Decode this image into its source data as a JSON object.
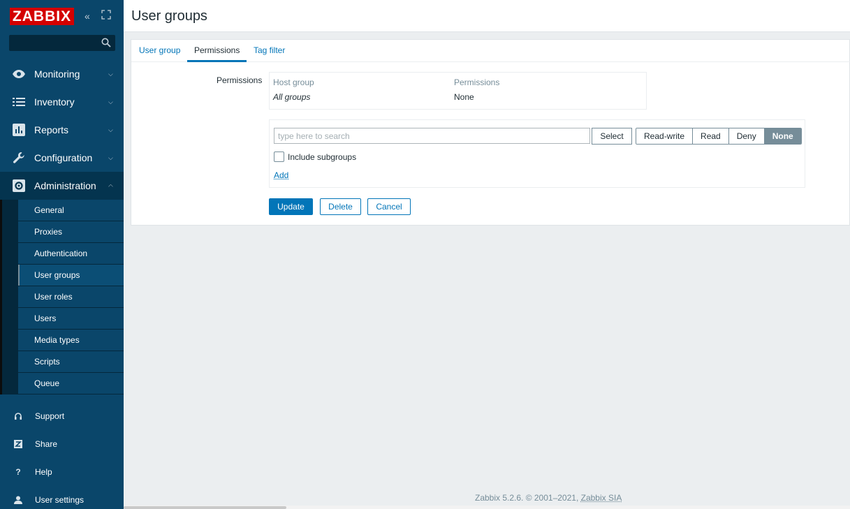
{
  "brand": {
    "logo": "ZABBIX",
    "color": "#d40000"
  },
  "sidebar": {
    "collapse_icon": "double-chevron-left-icon",
    "kiosk_icon": "expand-icon",
    "search_placeholder": "",
    "menu": [
      {
        "label": "Monitoring",
        "icon": "eye-icon"
      },
      {
        "label": "Inventory",
        "icon": "list-icon"
      },
      {
        "label": "Reports",
        "icon": "bar-chart-icon"
      },
      {
        "label": "Configuration",
        "icon": "wrench-icon"
      },
      {
        "label": "Administration",
        "icon": "gear-icon"
      }
    ],
    "submenu": [
      {
        "label": "General"
      },
      {
        "label": "Proxies"
      },
      {
        "label": "Authentication"
      },
      {
        "label": "User groups"
      },
      {
        "label": "User roles"
      },
      {
        "label": "Users"
      },
      {
        "label": "Media types"
      },
      {
        "label": "Scripts"
      },
      {
        "label": "Queue"
      }
    ],
    "bottom": [
      {
        "label": "Support",
        "icon": "headset-icon"
      },
      {
        "label": "Share",
        "icon": "share-z-icon"
      },
      {
        "label": "Help",
        "icon": "question-icon"
      },
      {
        "label": "User settings",
        "icon": "user-icon"
      }
    ]
  },
  "header": {
    "title": "User groups"
  },
  "tabs": [
    {
      "label": "User group"
    },
    {
      "label": "Permissions"
    },
    {
      "label": "Tag filter"
    }
  ],
  "permissions": {
    "field_label": "Permissions",
    "table": {
      "headers": [
        "Host group",
        "Permissions"
      ],
      "rows": [
        [
          "All groups",
          "None"
        ]
      ]
    },
    "search_placeholder": "type here to search",
    "select_label": "Select",
    "levels": [
      "Read-write",
      "Read",
      "Deny",
      "None"
    ],
    "selected_level": "None",
    "include_subgroups_label": "Include subgroups",
    "include_subgroups_checked": false,
    "add_label": "Add"
  },
  "actions": {
    "update": "Update",
    "delete": "Delete",
    "cancel": "Cancel"
  },
  "footer": {
    "text": "Zabbix 5.2.6. © 2001–2021, ",
    "company": "Zabbix SIA"
  },
  "colors": {
    "sidebar": "#0a466a",
    "accent": "#0275b8",
    "background": "#ebeef0"
  }
}
